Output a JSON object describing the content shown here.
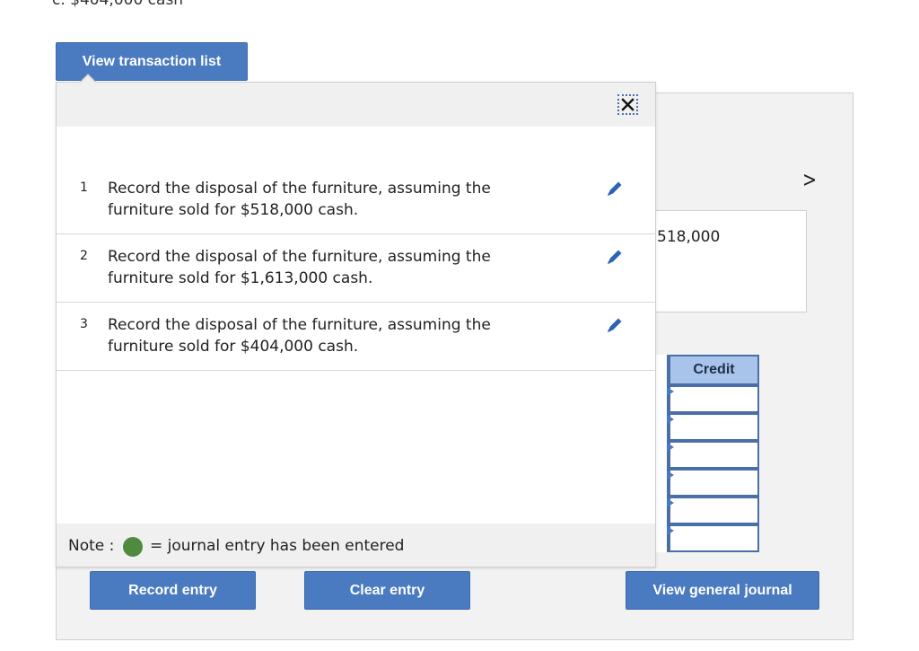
{
  "header": {
    "clipped_text": "c. $404,000 cash"
  },
  "buttons": {
    "view_transaction_list": "View transaction list",
    "record_entry": "Record entry",
    "clear_entry": "Clear entry",
    "view_general_journal": "View general journal"
  },
  "popup": {
    "close_icon": "close-icon",
    "transactions": [
      {
        "number": "1",
        "text": "Record the disposal of the furniture, assuming the furniture sold for $518,000 cash.",
        "icon": "pencil-icon"
      },
      {
        "number": "2",
        "text": "Record the disposal of the furniture, assuming the furniture sold for $1,613,000 cash.",
        "icon": "pencil-icon"
      },
      {
        "number": "3",
        "text": "Record the disposal of the furniture, assuming the furniture sold for $404,000 cash.",
        "icon": "pencil-icon"
      }
    ],
    "note": {
      "label": "Note :",
      "text": "= journal entry has been entered",
      "dot_color": "#4f8a3e"
    }
  },
  "journal": {
    "next_icon": "chevron-right-icon",
    "amount": "518,000",
    "credit_header": "Credit",
    "rows": [
      "",
      "",
      "",
      "",
      "",
      ""
    ]
  },
  "colors": {
    "button_blue": "#4a7ac0",
    "table_border": "#4a6fa8",
    "header_fill": "#a9c4ea"
  }
}
